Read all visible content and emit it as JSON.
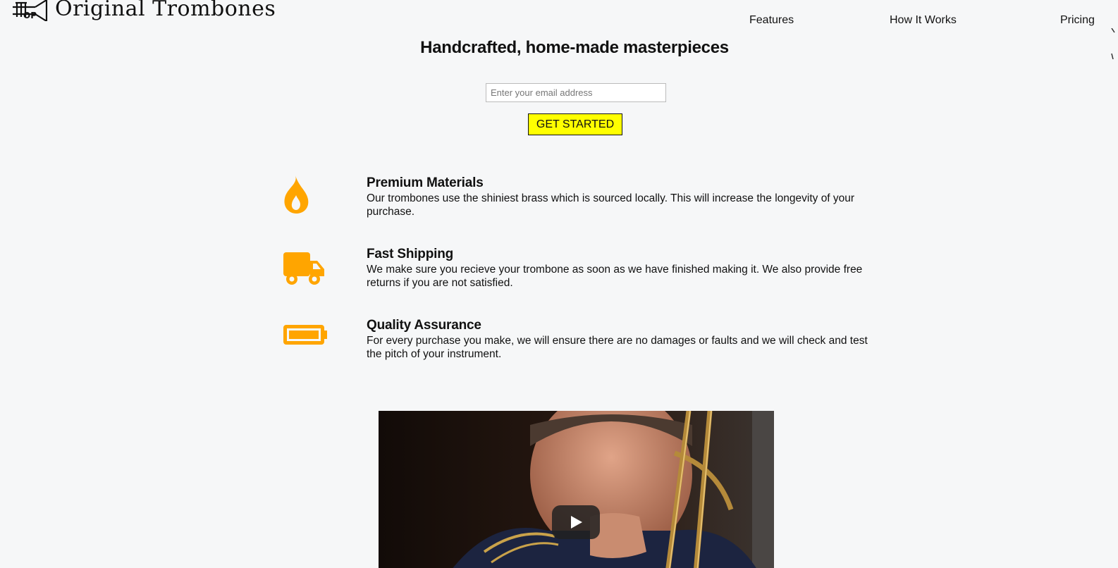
{
  "brand": {
    "name": "Original Trombones",
    "logo_icon": "trumpet-logo-icon"
  },
  "nav": {
    "items": [
      {
        "label": "Features"
      },
      {
        "label": "How It Works"
      },
      {
        "label": "Pricing"
      }
    ]
  },
  "hero": {
    "title": "Handcrafted, home-made masterpieces",
    "email_placeholder": "Enter your email address",
    "email_value": "",
    "cta_label": "GET STARTED"
  },
  "features": [
    {
      "icon": "fire-icon",
      "title": "Premium Materials",
      "description": "Our trombones use the shiniest brass which is sourced locally. This will increase the longevity of your purchase."
    },
    {
      "icon": "truck-icon",
      "title": "Fast Shipping",
      "description": "We make sure you recieve your trombone as soon as we have finished making it. We also provide free returns if you are not satisfied."
    },
    {
      "icon": "battery-icon",
      "title": "Quality Assurance",
      "description": "For every purchase you make, we will ensure there are no damages or faults and we will check and test the pitch of your instrument."
    }
  ],
  "video": {
    "play_icon": "play-icon"
  },
  "colors": {
    "background": "#f6f7f8",
    "accent_icon": "#ffa500",
    "cta_background": "#ffff00",
    "text": "#111111"
  }
}
